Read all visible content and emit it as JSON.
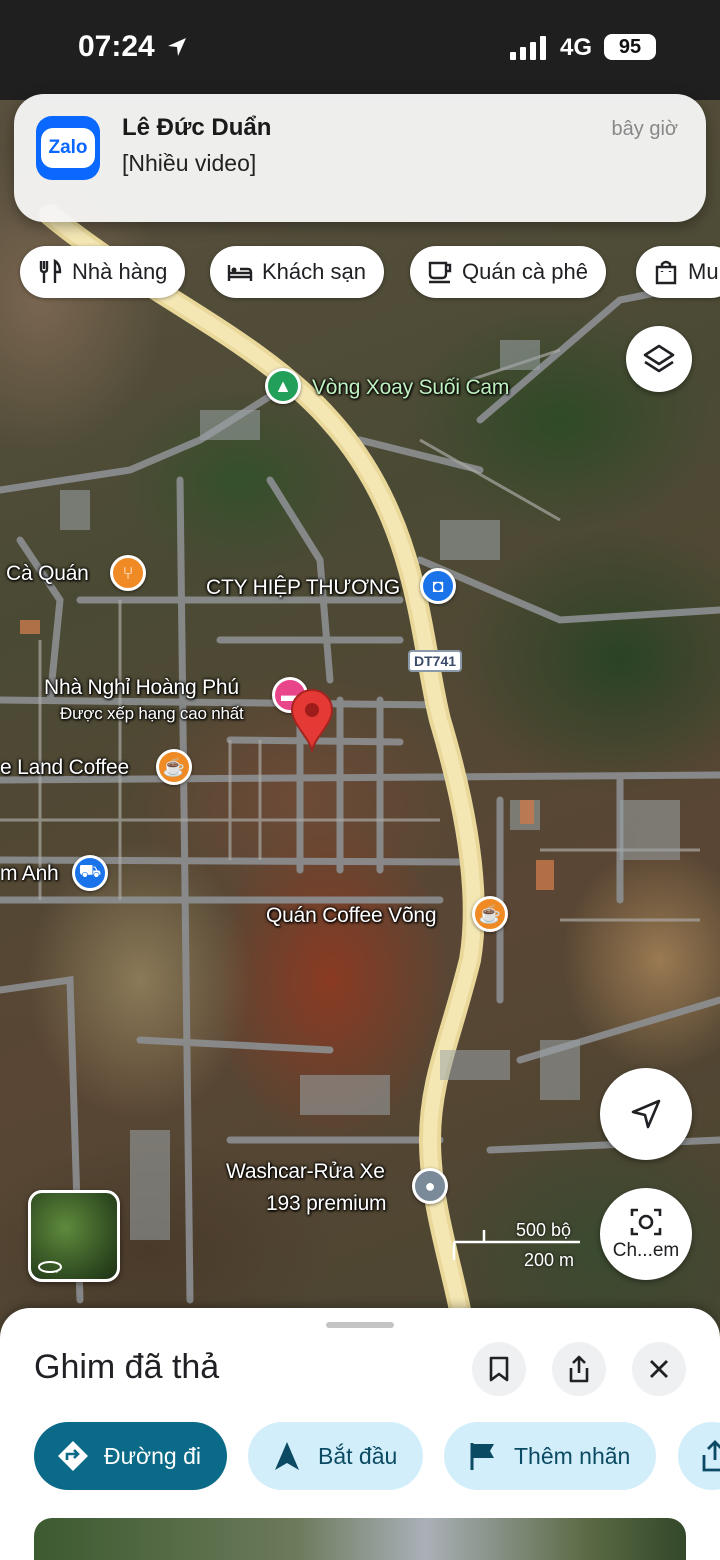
{
  "status_bar": {
    "time": "07:24",
    "network": "4G",
    "battery": "95"
  },
  "notification": {
    "app": "Zalo",
    "sender": "Lê Đức Duẩn",
    "message": "[Nhiều video]",
    "time": "bây giờ"
  },
  "categories": [
    {
      "label": "Nhà hàng",
      "icon": "restaurant-icon"
    },
    {
      "label": "Khách sạn",
      "icon": "hotel-icon"
    },
    {
      "label": "Quán cà phê",
      "icon": "coffee-icon"
    },
    {
      "label": "Mu",
      "icon": "shopping-bag-icon"
    }
  ],
  "map": {
    "places": [
      {
        "name": "Vòng Xoay Suối Cam",
        "type": "park"
      },
      {
        "name": "Cà Quán",
        "type": "restaurant"
      },
      {
        "name": "CTY HIỆP THƯƠNG",
        "type": "shop"
      },
      {
        "name": "Nhà Nghỉ Hoàng Phú",
        "subtitle": "Được xếp hạng cao nhất",
        "type": "hotel"
      },
      {
        "name": "e Land Coffee",
        "type": "cafe"
      },
      {
        "name": "m Anh",
        "type": "store"
      },
      {
        "name": "Quán Coffee Võng",
        "type": "cafe"
      },
      {
        "name": "Washcar-Rửa Xe",
        "name_line2": "193 premium",
        "type": "service"
      }
    ],
    "road_shield": "DT741",
    "scale": {
      "imperial": "500 bộ",
      "metric": "200 m"
    },
    "pin_color": "#e53935"
  },
  "buttons": {
    "lens_label": "Ch...em"
  },
  "sheet": {
    "title": "Ghim đã thả",
    "actions": [
      {
        "label": "Đường đi",
        "icon": "directions-icon"
      },
      {
        "label": "Bắt đầu",
        "icon": "navigation-arrow-icon"
      },
      {
        "label": "Thêm nhãn",
        "icon": "flag-icon"
      }
    ]
  },
  "colors": {
    "accent": "#0b6a87",
    "chip_bg": "#d3eefb",
    "road": "#e9d89a"
  }
}
